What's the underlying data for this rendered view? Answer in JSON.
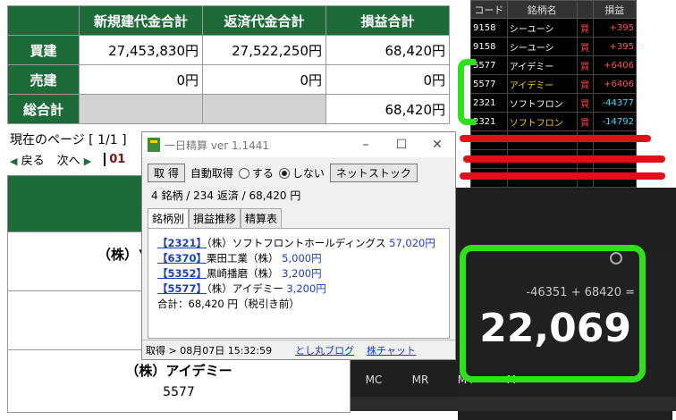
{
  "summary": {
    "headers": [
      "新規建代金合計",
      "返済代金合計",
      "損益合計"
    ],
    "rows": [
      {
        "label": "買建",
        "cells": [
          "27,453,830円",
          "27,522,250円",
          "68,420円"
        ]
      },
      {
        "label": "売建",
        "cells": [
          "0円",
          "0円",
          "0円"
        ]
      },
      {
        "label": "総合計",
        "cells": [
          "",
          "",
          "68,420円"
        ]
      }
    ]
  },
  "pager": {
    "current": "現在のページ [ 1/1 ]",
    "back": "戻る",
    "next": "次へ",
    "page": "01"
  },
  "lower": {
    "row1_name": "（株）ソ",
    "row3_name": "（株）アイデミー",
    "row3_code": "5577"
  },
  "quote": {
    "headers": [
      "コード",
      "銘柄名",
      "",
      "損益"
    ],
    "rows": [
      {
        "code": "9158",
        "name": "シーユーシ",
        "side": "買",
        "pl": "+395",
        "style": "plus"
      },
      {
        "code": "9158",
        "name": "シーユーシ",
        "side": "買",
        "pl": "+395",
        "style": "plus"
      },
      {
        "code": "5577",
        "name": "アイデミー",
        "side": "買",
        "pl": "+6406",
        "style": "plus"
      },
      {
        "code": "5577",
        "name": "アイデミー",
        "side": "買",
        "pl": "+6406",
        "style": "plus"
      },
      {
        "code": "2321",
        "name": "ソフトフロン",
        "side": "買",
        "pl": "-44377",
        "style": "minus"
      },
      {
        "code": "2321",
        "name": "ソフトフロン",
        "side": "買",
        "pl": "-14792",
        "style": "minus"
      }
    ]
  },
  "calc": {
    "expression": "-46351 + 68420 =",
    "result": "22,069",
    "mkeys": [
      "MC",
      "MR",
      "M+",
      "M-"
    ]
  },
  "window": {
    "title": "一日精算 ver 1.1441",
    "get_btn": "取 得",
    "auto_label": "自動取得",
    "opt_on": "する",
    "opt_off": "しない",
    "net_btn": "ネットストック",
    "stats": "4 銘柄 / 234 返済 / 68,420 円",
    "tabs": [
      "銘柄別",
      "損益推移",
      "精算表"
    ],
    "items": [
      {
        "code": "【2321】",
        "name": "（株）ソフトフロントホールディングス",
        "amount": "57,020円"
      },
      {
        "code": "【6370】",
        "name": "栗田工業（株）",
        "amount": "5,000円"
      },
      {
        "code": "【5352】",
        "name": "黒崎播磨（株）",
        "amount": "3,200円"
      },
      {
        "code": "【5577】",
        "name": "（株）アイデミー",
        "amount": "3,200円"
      }
    ],
    "total": "合計：68,420 円（税引き前）",
    "status_time": "取得 > 08月07日 15:32:59",
    "link_blog": "とし丸ブログ",
    "link_chart": "株チャット"
  },
  "colors": {
    "header_green": "#1e6b3a",
    "mark_green": "#2fe01a",
    "mark_red": "#e0101a"
  }
}
